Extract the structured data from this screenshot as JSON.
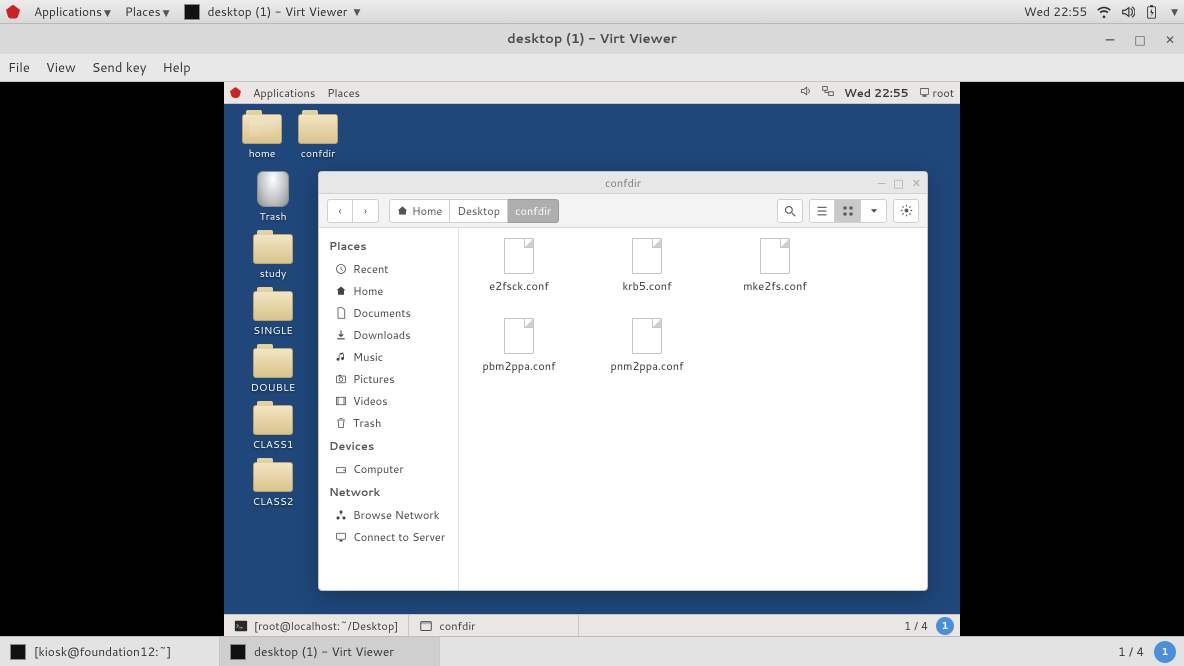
{
  "host_top": {
    "apps": "Applications",
    "places": "Places",
    "active_win": "desktop (1) - Virt Viewer",
    "clock": "Wed 22:55"
  },
  "vv": {
    "title": "desktop (1) - Virt Viewer",
    "menu": {
      "file": "File",
      "view": "View",
      "sendkey": "Send key",
      "help": "Help"
    }
  },
  "guest_top": {
    "apps": "Applications",
    "places": "Places",
    "clock": "Wed 22:55",
    "user": "root"
  },
  "desktop_icons": {
    "home": "home",
    "confdir": "confdir",
    "trash": "Trash",
    "study": "study",
    "single": "SINGLE",
    "double": "DOUBLE",
    "class1": "CLASS1",
    "class2": "CLASS2"
  },
  "nautilus": {
    "title": "confdir",
    "path": {
      "home": "Home",
      "desktop": "Desktop",
      "confdir": "confdir"
    },
    "sidebar": {
      "places_hdr": "Places",
      "recent": "Recent",
      "home": "Home",
      "documents": "Documents",
      "downloads": "Downloads",
      "music": "Music",
      "pictures": "Pictures",
      "videos": "Videos",
      "trash": "Trash",
      "devices_hdr": "Devices",
      "computer": "Computer",
      "network_hdr": "Network",
      "browse": "Browse Network",
      "connect": "Connect to Server"
    },
    "files": {
      "f0": "e2fsck.conf",
      "f1": "krb5.conf",
      "f2": "mke2fs.conf",
      "f3": "pbm2ppa.conf",
      "f4": "pnm2ppa.conf"
    }
  },
  "guest_bot": {
    "task1": "[root@localhost:~/Desktop]",
    "task2": "confdir",
    "ws": "1 / 4",
    "wsnum": "1"
  },
  "host_bot": {
    "task1": "[kiosk@foundation12:~]",
    "task2": "desktop (1) - Virt Viewer",
    "ws": "1 / 4",
    "wsnum": "1"
  }
}
